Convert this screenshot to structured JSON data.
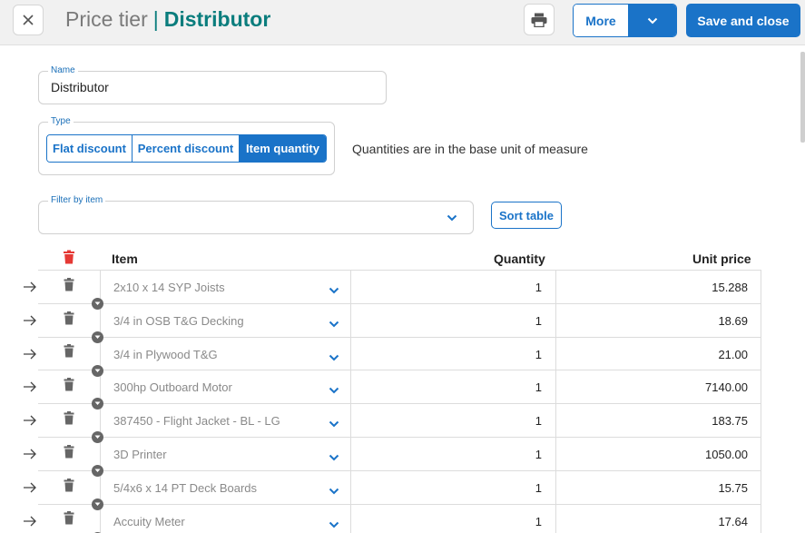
{
  "header": {
    "title_prefix": "Price tier",
    "title_separator": "|",
    "title_name": "Distributor",
    "more_label": "More",
    "save_label": "Save and close"
  },
  "name_field": {
    "legend": "Name",
    "value": "Distributor"
  },
  "type_field": {
    "legend": "Type",
    "options": [
      "Flat discount",
      "Percent discount",
      "Item quantity"
    ],
    "selected": "Item quantity",
    "note": "Quantities are in the base unit of measure"
  },
  "filter_field": {
    "legend": "Filter by item",
    "value": ""
  },
  "sort_label": "Sort table",
  "table": {
    "columns": {
      "item": "Item",
      "quantity": "Quantity",
      "unit_price": "Unit price"
    },
    "rows": [
      {
        "item": "2x10 x 14 SYP Joists",
        "quantity": "1",
        "unit_price": "15.288"
      },
      {
        "item": "3/4 in OSB T&G Decking",
        "quantity": "1",
        "unit_price": "18.69"
      },
      {
        "item": "3/4 in Plywood T&G",
        "quantity": "1",
        "unit_price": "21.00"
      },
      {
        "item": "300hp Outboard Motor",
        "quantity": "1",
        "unit_price": "7140.00"
      },
      {
        "item": "387450 - Flight Jacket - BL - LG",
        "quantity": "1",
        "unit_price": "183.75"
      },
      {
        "item": "3D Printer",
        "quantity": "1",
        "unit_price": "1050.00"
      },
      {
        "item": "5/4x6 x 14 PT Deck Boards",
        "quantity": "1",
        "unit_price": "15.75"
      },
      {
        "item": "Accuity Meter",
        "quantity": "1",
        "unit_price": "17.64"
      }
    ]
  },
  "colors": {
    "accent": "#1a73c8",
    "title_teal": "#0a7d7d",
    "delete_red": "#e53935"
  },
  "icons": [
    "close-icon",
    "print-icon",
    "chevron-down-icon",
    "trash-icon",
    "arrow-right-icon",
    "expand-dot-icon"
  ]
}
